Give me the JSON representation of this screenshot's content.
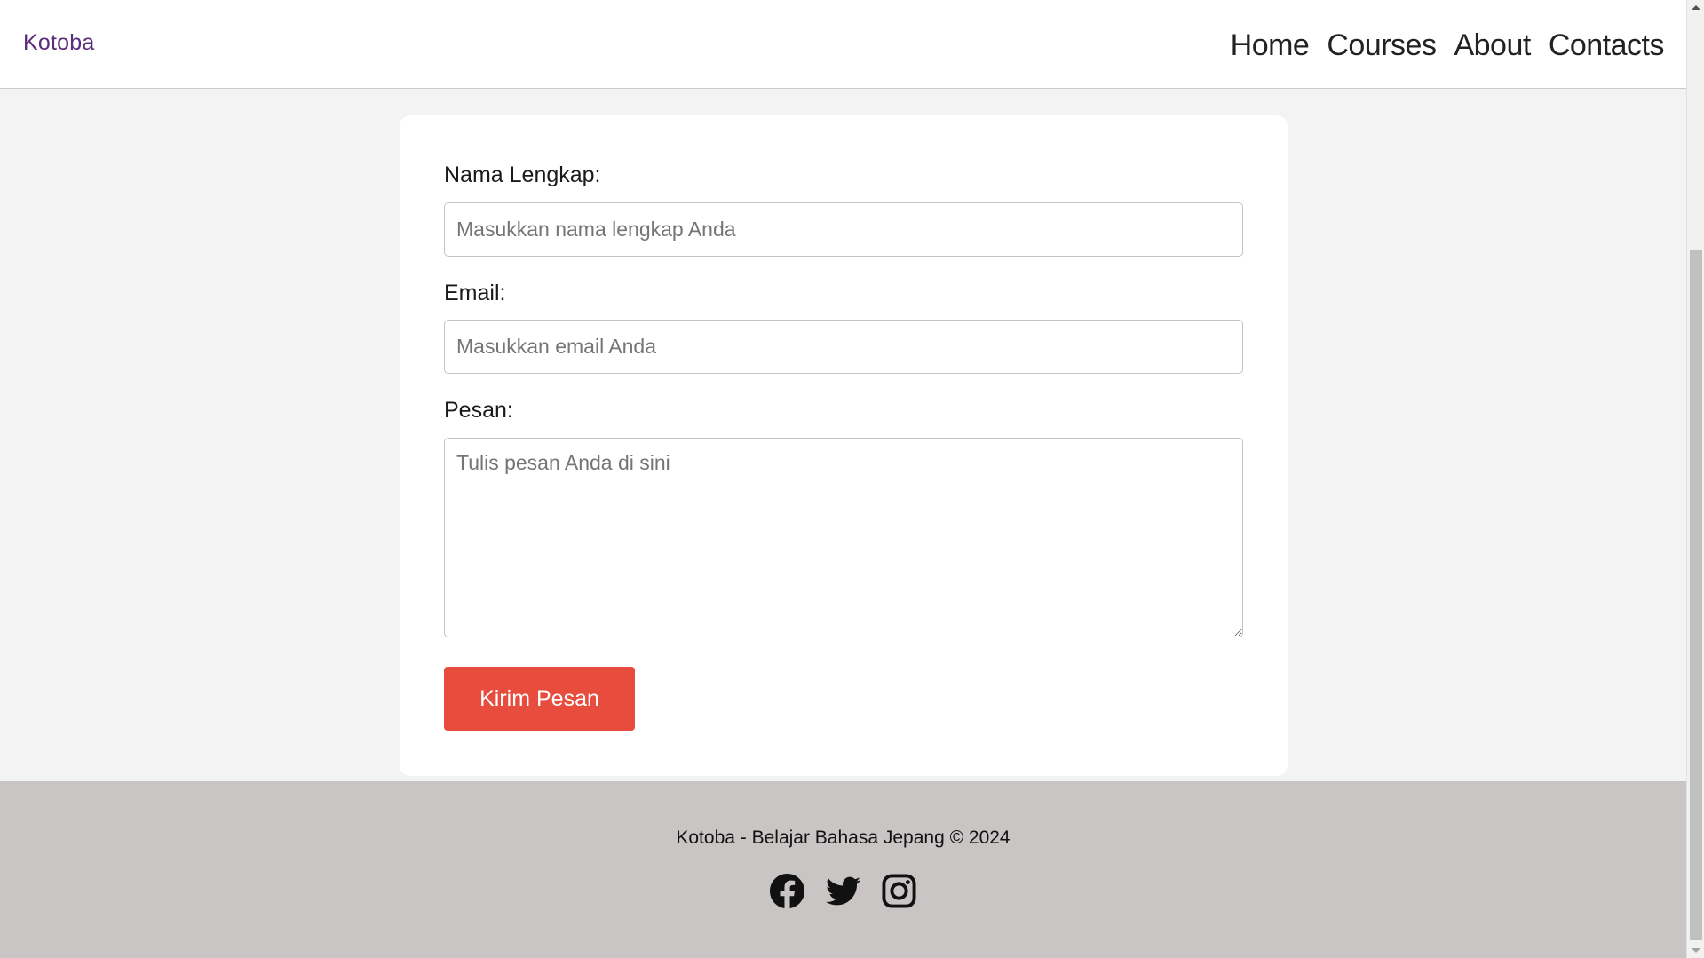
{
  "header": {
    "brand": "Kotoba",
    "nav": [
      {
        "label": "Home"
      },
      {
        "label": "Courses"
      },
      {
        "label": "About"
      },
      {
        "label": "Contacts"
      }
    ]
  },
  "form": {
    "name_label": "Nama Lengkap:",
    "name_placeholder": "Masukkan nama lengkap Anda",
    "email_label": "Email:",
    "email_placeholder": "Masukkan email Anda",
    "message_label": "Pesan:",
    "message_placeholder": "Tulis pesan Anda di sini",
    "submit_label": "Kirim Pesan"
  },
  "footer": {
    "text": "Kotoba - Belajar Bahasa Jepang © 2024",
    "social": [
      {
        "icon": "facebook-icon"
      },
      {
        "icon": "twitter-icon"
      },
      {
        "icon": "instagram-icon"
      }
    ]
  },
  "colors": {
    "brand": "#5b2d7a",
    "button": "#e74c3c",
    "footer_bg": "#cac5c5",
    "page_bg": "#f3f3f3"
  }
}
